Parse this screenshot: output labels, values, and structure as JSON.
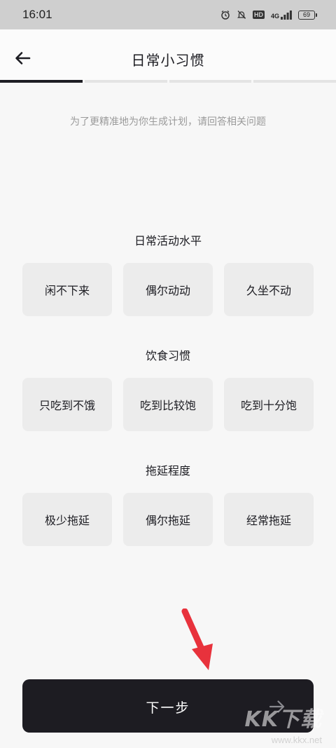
{
  "status_bar": {
    "time": "16:01",
    "icons": [
      "alarm-icon",
      "mute-icon",
      "hd-icon",
      "signal-icon",
      "battery-icon"
    ],
    "hd_label": "HD",
    "network_label": "4G",
    "battery_level": "69"
  },
  "header": {
    "back_icon": "arrow-left-icon",
    "title": "日常小习惯"
  },
  "progress": {
    "total_steps": 4,
    "current_step": 1,
    "active_color": "#1d1d23"
  },
  "subtitle": "为了更精准地为你生成计划，请回答相关问题",
  "sections": [
    {
      "title": "日常活动水平",
      "options": [
        "闲不下来",
        "偶尔动动",
        "久坐不动"
      ]
    },
    {
      "title": "饮食习惯",
      "options": [
        "只吃到不饿",
        "吃到比较饱",
        "吃到十分饱"
      ]
    },
    {
      "title": "拖延程度",
      "options": [
        "极少拖延",
        "偶尔拖延",
        "经常拖延"
      ]
    }
  ],
  "next_button": {
    "label": "下一步",
    "icon": "arrow-right-icon"
  },
  "annotation": {
    "icon": "red-pointer-arrow-icon",
    "color": "#e8323c"
  },
  "watermark": {
    "text": "KK下载",
    "url": "www.kkx.net"
  }
}
